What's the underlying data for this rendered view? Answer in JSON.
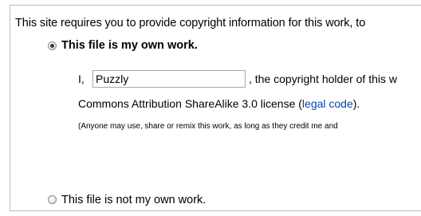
{
  "intro_text": "This site requires you to provide copyright information for this work, to",
  "own_work": {
    "label": "This file is my own work.",
    "selected": true,
    "prefix": "I,",
    "author_value": "Puzzly",
    "suffix": ", the copyright holder of this w",
    "license_text": "Commons Attribution ShareAlike 3.0 license (",
    "license_link": "legal code",
    "license_close": ").",
    "fine_print": "(Anyone may use, share or remix this work, as long as they credit me and"
  },
  "not_own_work": {
    "label": "This file is not my own work.",
    "selected": false
  },
  "colors": {
    "link": "#0645ad",
    "border": "#bdbdbd"
  }
}
